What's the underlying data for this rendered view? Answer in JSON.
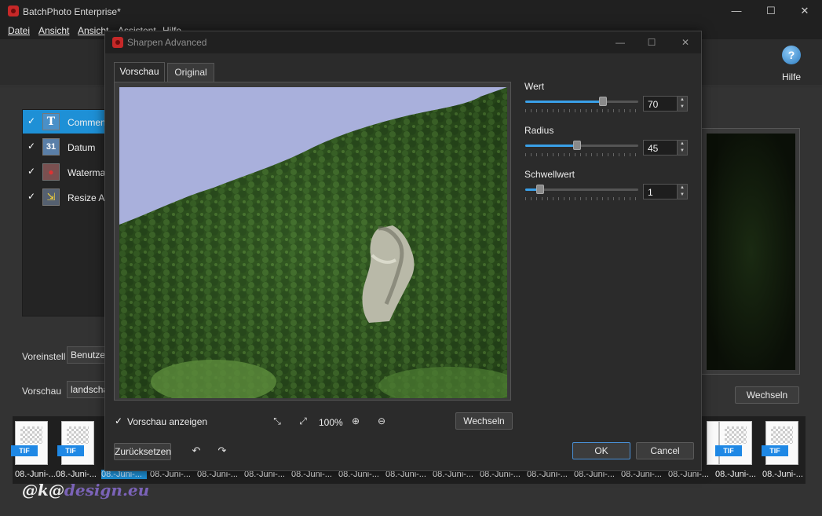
{
  "window": {
    "title": "BatchPhoto Enterprise*",
    "minimize": "—",
    "maximize": "☐",
    "close": "✕"
  },
  "menu": [
    "Datei",
    "Ansicht",
    "Ansicht",
    "Assistent",
    "Hilfe"
  ],
  "toolbar": {
    "help_label": "Hilfe",
    "help_icon_glyph": "?"
  },
  "actions": [
    {
      "label": "Comment",
      "icon": "text-T-icon",
      "checked": "✓"
    },
    {
      "label": "Datum",
      "icon": "calendar-31-icon",
      "checked": "✓"
    },
    {
      "label": "Watermark",
      "icon": "watermark-icon",
      "checked": "✓"
    },
    {
      "label": "Resize Advanced",
      "icon": "resize-icon",
      "checked": "✓"
    }
  ],
  "action_icon_glyphs": [
    "T",
    "31",
    "●",
    "⇲"
  ],
  "side": {
    "preset_label": "Voreinstell",
    "preset_value": "Benutzer",
    "preview_label": "Vorschau",
    "preview_value": "landschaft"
  },
  "right_panel": {
    "switch_button": "Wechseln"
  },
  "thumbnails": {
    "badge": "TIF",
    "labels": [
      "08.-Juni-...",
      "08.-Juni-...",
      "08.-Juni-...",
      "08.-Juni-...",
      "08.-Juni-...",
      "08.-Juni-...",
      "08.-Juni-...",
      "08.-Juni-...",
      "08.-Juni-...",
      "08.-Juni-...",
      "08.-Juni-...",
      "08.-Juni-...",
      "08.-Juni-...",
      "08.-Juni-...",
      "08.-Juni-...",
      "08.-Juni-...",
      "08.-Juni-..."
    ],
    "selected_index": 2
  },
  "watermark": {
    "prefix": "@k@",
    "suffix": "design.eu"
  },
  "dialog": {
    "title": "Sharpen Advanced",
    "tabs": [
      "Vorschau",
      "Original"
    ],
    "active_tab": 0,
    "sliders": [
      {
        "label": "Wert",
        "value": "70",
        "fraction": 0.7
      },
      {
        "label": "Radius",
        "value": "45",
        "fraction": 0.45
      },
      {
        "label": "Schwellwert",
        "value": "1",
        "fraction": 0.13
      }
    ],
    "show_preview": {
      "label": "Vorschau anzeigen",
      "checked": "✓"
    },
    "zoom": "100%",
    "switch_button": "Wechseln",
    "reset_button": "Zurücksetzen",
    "ok_button": "OK",
    "cancel_button": "Cancel"
  }
}
